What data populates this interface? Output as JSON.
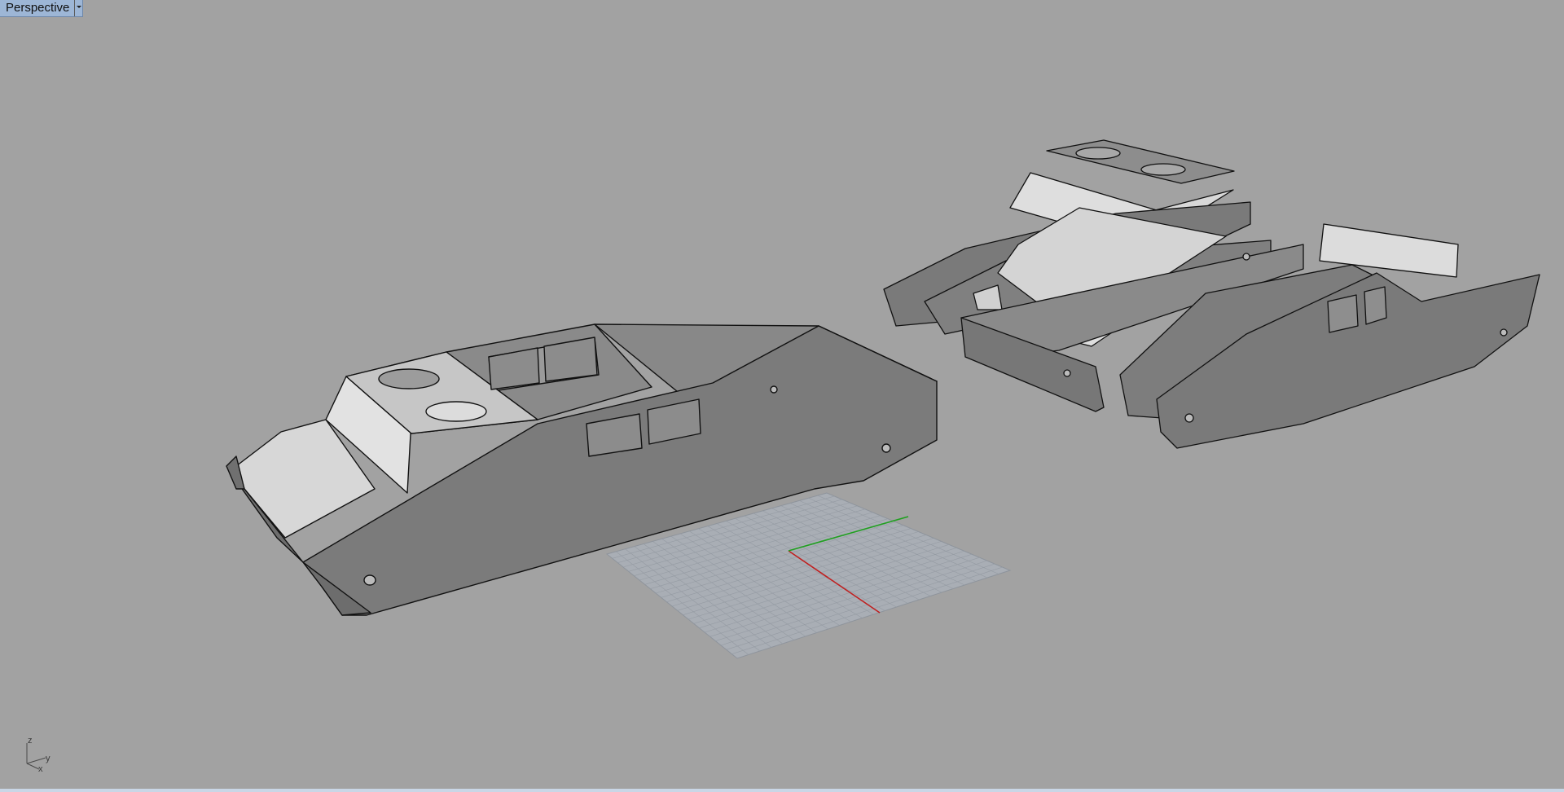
{
  "viewport": {
    "title": "Perspective",
    "menu_icon": "chevron-down-icon",
    "background": "#a2a2a2"
  },
  "axis_gizmo": {
    "z_label": "z",
    "y_label": "y",
    "x_label": "x"
  },
  "colors": {
    "grid_x_axis": "#c02020",
    "grid_y_axis": "#20a020",
    "part_dark": "#7a7a7a",
    "part_light": "#d6d6d6"
  }
}
